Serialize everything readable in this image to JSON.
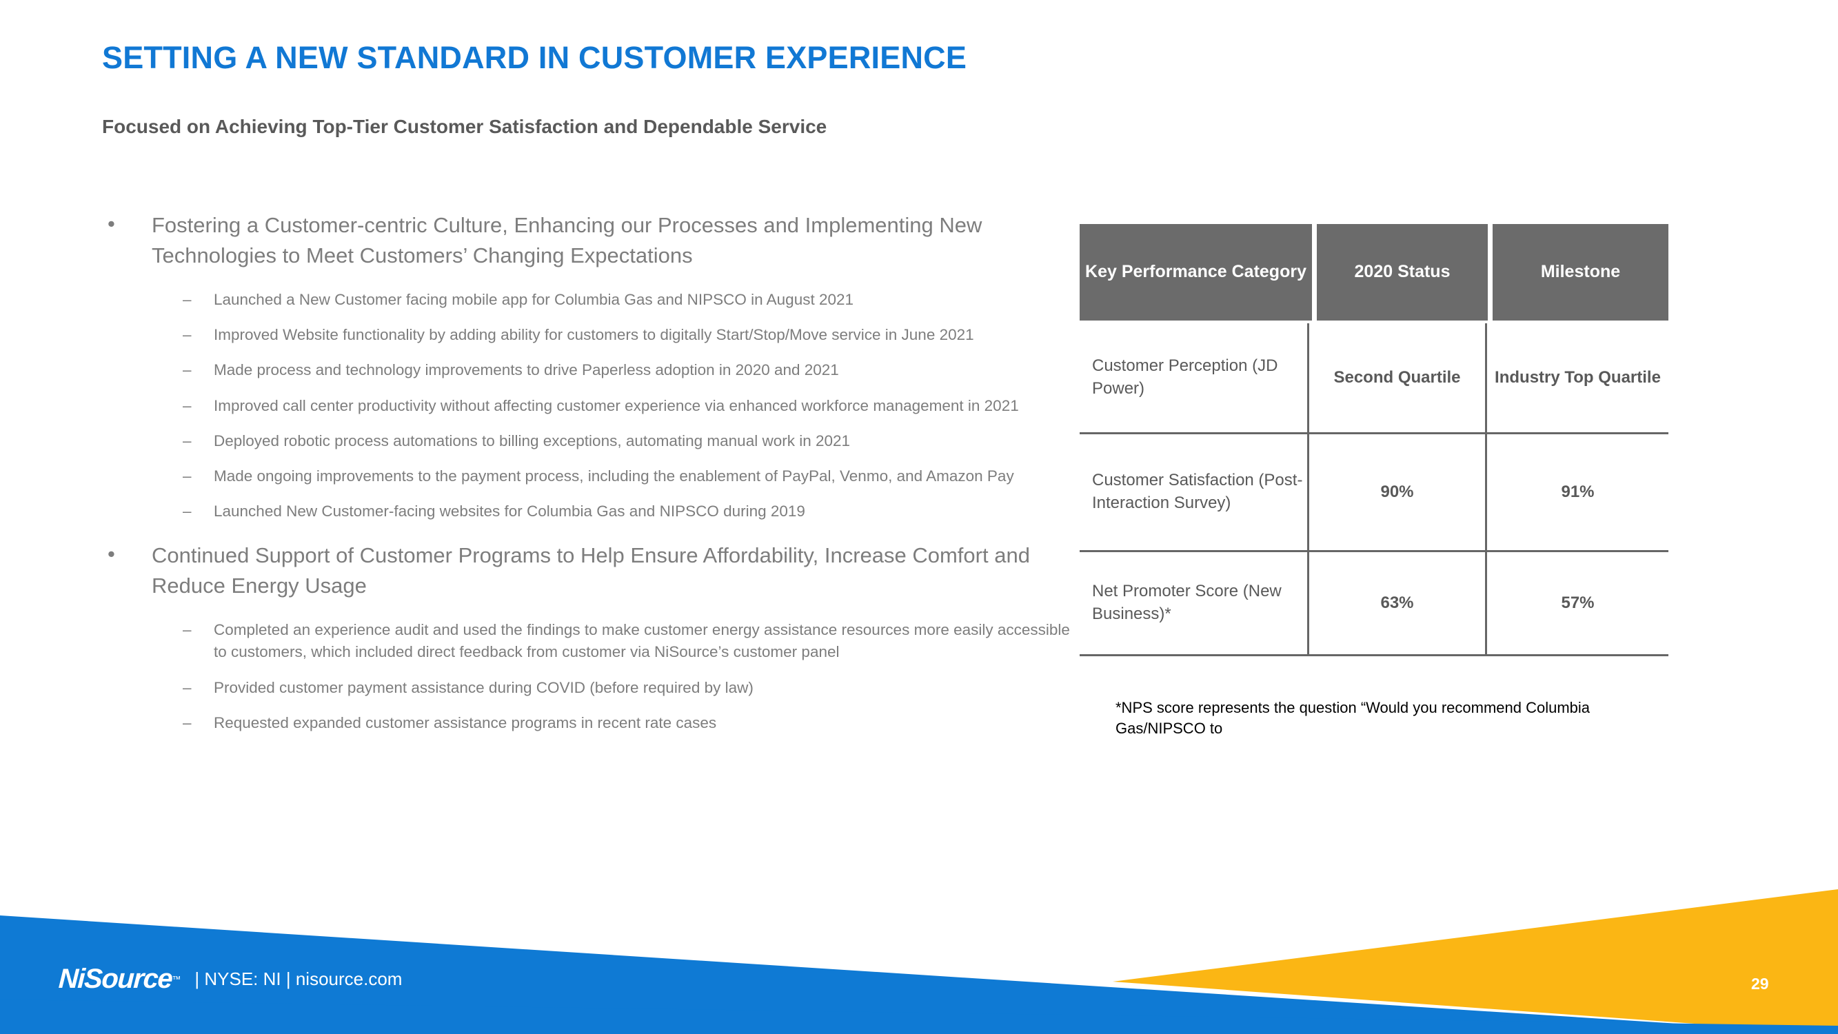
{
  "slide": {
    "title": "SETTING A NEW STANDARD IN CUSTOMER EXPERIENCE",
    "subtitle": "Focused on Achieving Top-Tier Customer Satisfaction and Dependable Service",
    "page_number": "29",
    "colors": {
      "title_blue": "#1178d4",
      "body_gray": "#7d7d7d",
      "subtitle_gray": "#595959",
      "table_header_gray": "#6b6b6b",
      "footer_blue": "#0f7ad4",
      "footer_yellow": "#fbb614"
    }
  },
  "bullets": {
    "section1": {
      "text": "Fostering a Customer-centric Culture, Enhancing our Processes and Implementing New Technologies to Meet Customers’ Changing Expectations",
      "marker": "•",
      "sub_marker": "–",
      "items": [
        "Launched a New Customer facing mobile app for Columbia Gas and NIPSCO in August 2021",
        "Improved Website functionality by adding ability for customers to digitally Start/Stop/Move service in June 2021",
        "Made process and technology improvements to drive Paperless adoption in 2020 and 2021",
        "Improved call center productivity without affecting customer experience via enhanced workforce management in 2021",
        "Deployed robotic process automations to billing exceptions, automating manual work in 2021",
        "Made ongoing improvements to the payment process, including the enablement of PayPal, Venmo, and Amazon Pay",
        "Launched New Customer-facing websites for Columbia Gas and NIPSCO during 2019"
      ]
    },
    "section2": {
      "text": "Continued Support of Customer Programs to Help Ensure Affordability, Increase Comfort and Reduce Energy Usage",
      "marker": "•",
      "sub_marker": "–",
      "items": [
        "Completed an experience audit and used the findings to make customer energy assistance resources more easily accessible to customers, which included direct feedback from customer via NiSource’s customer panel",
        "Provided customer payment assistance during COVID (before required by law)",
        "Requested expanded customer assistance programs in recent rate cases"
      ]
    }
  },
  "table": {
    "headers": [
      "Key Performance Category",
      "2020 Status",
      "Milestone"
    ],
    "rows": [
      {
        "category": "Customer Perception (JD Power)",
        "status": "Second Quartile",
        "milestone": "Industry Top Quartile"
      },
      {
        "category": "Customer Satisfaction (Post-Interaction Survey)",
        "status": "90%",
        "milestone": "91%"
      },
      {
        "category": "Net Promoter Score (New Business)*",
        "status": "63%",
        "milestone": "57%"
      }
    ]
  },
  "footnote": "*NPS score represents the question “Would you recommend Columbia Gas/NIPSCO to",
  "footer": {
    "logo_text": "NiSource",
    "logo_tm": "™",
    "meta": "|  NYSE: NI  |  nisource.com"
  }
}
